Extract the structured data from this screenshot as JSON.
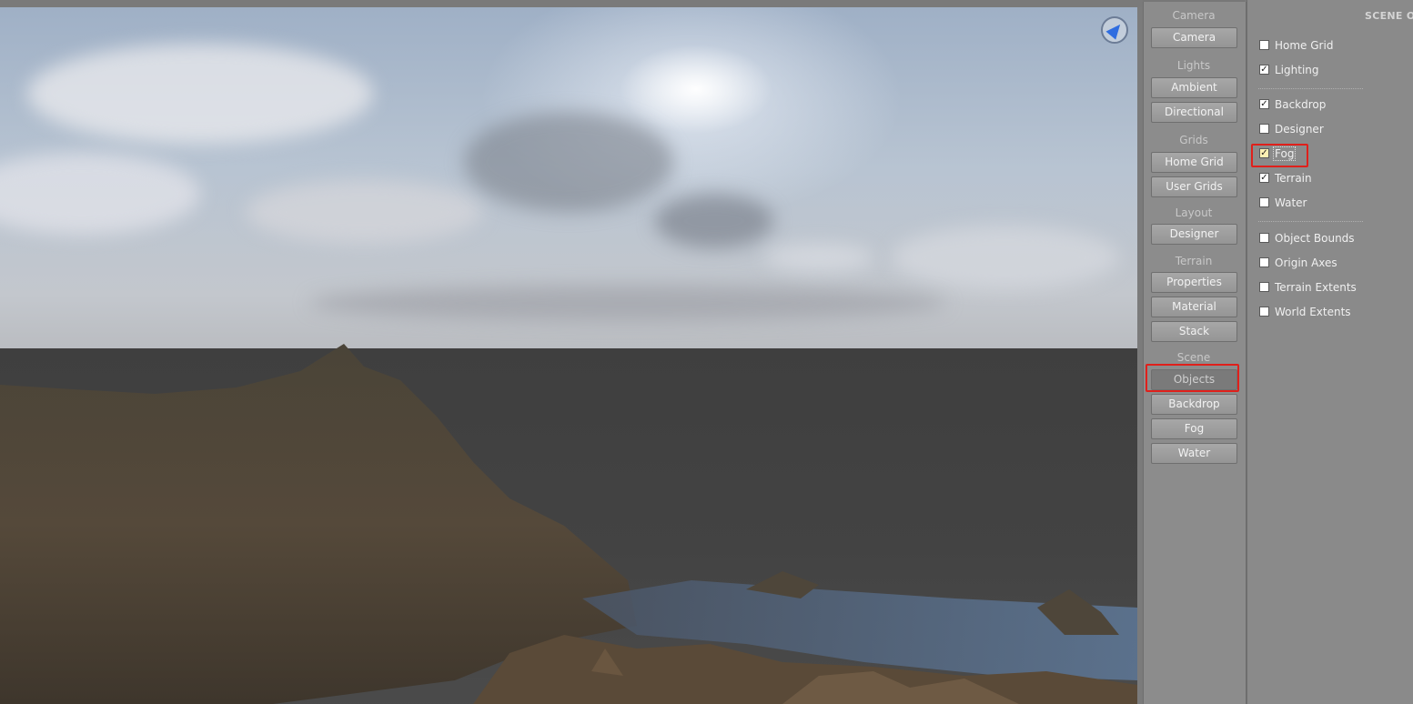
{
  "viewport": {
    "sky_color": "#b4c1d1",
    "ground_color": "#444444",
    "compass_icon": "navigation-compass-icon"
  },
  "tools": {
    "sections": [
      {
        "label": "Camera",
        "buttons": [
          "Camera"
        ]
      },
      {
        "label": "Lights",
        "buttons": [
          "Ambient",
          "Directional"
        ]
      },
      {
        "label": "Grids",
        "buttons": [
          "Home Grid",
          "User Grids"
        ]
      },
      {
        "label": "Layout",
        "buttons": [
          "Designer"
        ]
      },
      {
        "label": "Terrain",
        "buttons": [
          "Properties",
          "Material",
          "Stack"
        ]
      },
      {
        "label": "Scene",
        "buttons": [
          "Objects",
          "Backdrop",
          "Fog",
          "Water"
        ]
      }
    ],
    "active_button": "Objects"
  },
  "options": {
    "title": "SCENE O",
    "groups": [
      [
        {
          "label": "Home Grid",
          "checked": false
        },
        {
          "label": "Lighting",
          "checked": true
        }
      ],
      [
        {
          "label": "Backdrop",
          "checked": true
        },
        {
          "label": "Designer",
          "checked": false
        },
        {
          "label": "Fog",
          "checked": true
        },
        {
          "label": "Terrain",
          "checked": true
        },
        {
          "label": "Water",
          "checked": false
        }
      ],
      [
        {
          "label": "Object Bounds",
          "checked": false
        },
        {
          "label": "Origin Axes",
          "checked": false
        },
        {
          "label": "Terrain Extents",
          "checked": false
        },
        {
          "label": "World Extents",
          "checked": false
        }
      ]
    ]
  },
  "highlight_color": "#e0201b"
}
